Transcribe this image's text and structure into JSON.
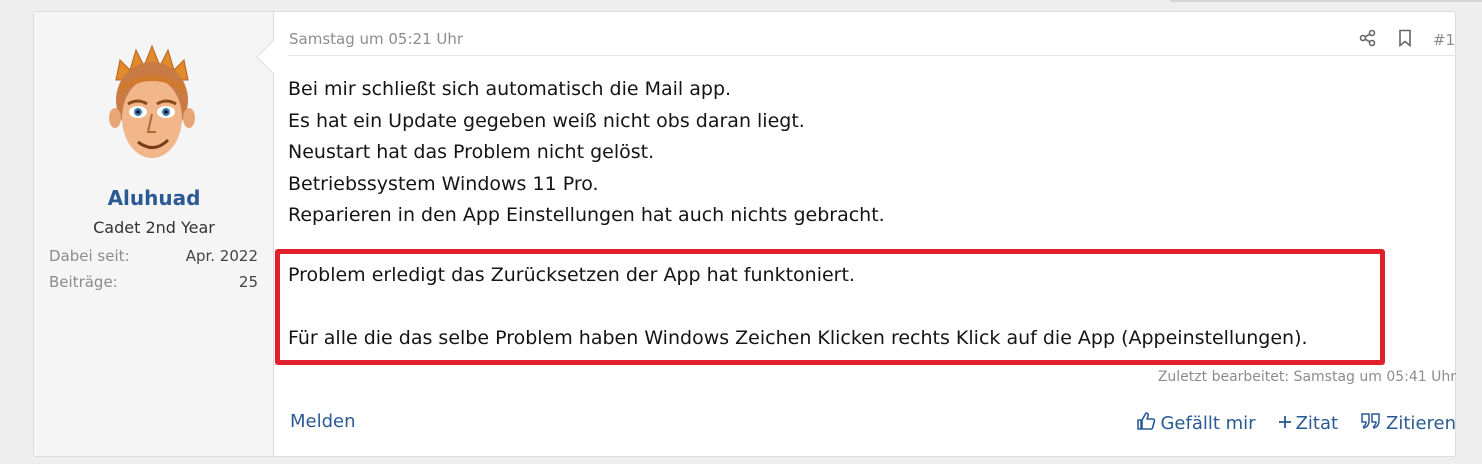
{
  "user": {
    "name": "Aluhuad",
    "title": "Cadet 2nd Year",
    "joined_label": "Dabei seit:",
    "joined_value": "Apr. 2022",
    "posts_label": "Beiträge:",
    "posts_value": "25"
  },
  "post": {
    "date": "Samstag um 05:21 Uhr",
    "number": "#1",
    "icons": [
      "share-icon",
      "bookmark-icon"
    ],
    "lines": [
      "Bei mir schließt sich automatisch die Mail app.",
      "Es hat ein Update gegeben weiß nicht obs daran liegt.",
      "Neustart hat das Problem nicht gelöst.",
      "Betriebssystem Windows 11 Pro.",
      "Reparieren in den App Einstellungen hat auch nichts gebracht."
    ],
    "highlight_lines": [
      "Problem erledigt das Zurücksetzen der App hat funktoniert.",
      "Für alle die das selbe Problem haben Windows Zeichen Klicken rechts Klick auf die App (Appeinstellungen)."
    ],
    "edited": "Zuletzt bearbeitet: Samstag um 05:41 Uhr"
  },
  "actions": {
    "report": "Melden",
    "like": "Gefällt mir",
    "quote": "Zitat",
    "reply": "Zitieren"
  },
  "colors": {
    "link": "#2a5a94",
    "highlight_border": "#e0202a"
  }
}
